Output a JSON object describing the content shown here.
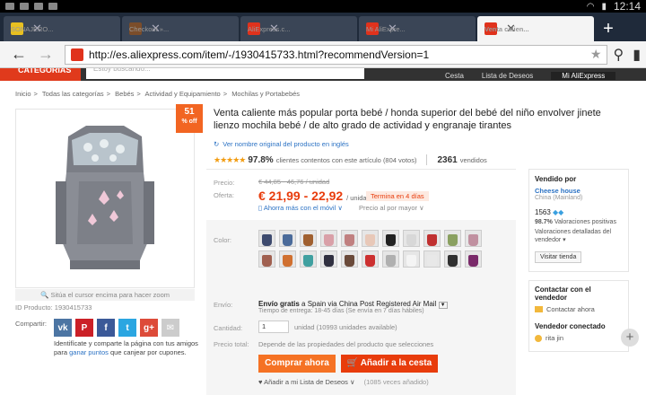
{
  "status": {
    "clock": "12:14"
  },
  "tabs": [
    {
      "label": "SONAJERO...",
      "color": "#e8c020",
      "active": false
    },
    {
      "label": "Checkout »...",
      "color": "#7b4d2a",
      "active": false
    },
    {
      "label": "AliExpress.c...",
      "color": "#e0321c",
      "active": false
    },
    {
      "label": "Mi AliExpre...",
      "color": "#e0321c",
      "active": false
    },
    {
      "label": "Venta calien...",
      "color": "#e0321c",
      "active": true
    }
  ],
  "url": "http://es.aliexpress.com/item/-/1930415733.html?recommendVersion=1",
  "header": {
    "categories": "CATEGORÍAS",
    "search_placeholder": "Estoy buscando...",
    "cart": "Cesta",
    "wishlist": "Lista de Deseos",
    "my": "Mi AliExpress"
  },
  "breadcrumb": [
    "Inicio",
    ">",
    "Todas las categorías",
    ">",
    "Bebés",
    ">",
    "Actividad y Equipamiento",
    ">",
    "Mochilas y Portabebés"
  ],
  "product": {
    "title": "Venta caliente más popular porta bebé / honda superior del bebé del niño envolver jinete lienzo mochila bebé / de alto grado de actividad y engranaje tirantes",
    "original_link": "Ver nombre original del producto en inglés",
    "stars": "★★★★★",
    "rating": "97.8%",
    "rating_text": "clientes contentos con este artículo (804 votos)",
    "sold_count": "2361",
    "sold_label": "vendidos",
    "discount_pct": "51",
    "discount_label": "% off",
    "price_label": "Precio:",
    "old_price": "€ 44,85 - 46,76",
    "old_unit": "/ unidad",
    "offer_label": "Oferta:",
    "price": "€ 21,99 - 22,92",
    "unit": "/ unidad",
    "timer": "Termina en 4 días",
    "mobile": "Ahorra más con el móvil",
    "bulk": "Precio al por mayor",
    "zoom_hint": "Sitúa el cursor encima para hacer zoom",
    "id_line": "ID Producto: 1930415733",
    "color_label": "Color:",
    "colors": [
      "#3d4a6e",
      "#4b6b9a",
      "#a06030",
      "#d9a0a8",
      "#c08080",
      "#e8c8b8",
      "#222222",
      "#d8d8d8",
      "#c03030",
      "#8aa060",
      "#c090a0",
      "#a06050",
      "#d07030",
      "#40a0a0",
      "#303040",
      "#6a4a3a",
      "#cc3030",
      "#b0b0b0",
      "#f4f4f4",
      "#e8e8e8",
      "#303030",
      "#7a2a6a"
    ],
    "ship_label": "Envío:",
    "ship_free": "Envío gratis",
    "ship_dest": "a   Spain via China Post Registered Air Mail",
    "ship_note": "Tiempo de entrega: 18-45 días (Se envía en 7 días hábiles)",
    "qty_label": "Cantidad:",
    "qty": "1",
    "qty_unit": "unidad (10993 unidades available)",
    "total_label": "Precio total:",
    "total_text": "Depende de las propiedades del producto que selecciones",
    "buy_now": "Comprar ahora",
    "add_cart": "Añadir a la cesta",
    "wishlist": "Añadir a mi Lista de Deseos ∨",
    "wish_count": "(1085 veces añadido)"
  },
  "share": {
    "label": "Compartir:",
    "note_1": "Identifícate y comparte la página con tus amigos para",
    "note_link": "ganar puntos",
    "note_2": "que canjear por cupones.",
    "icons": [
      {
        "name": "vk-icon",
        "glyph": "vk",
        "color": "#4c75a3"
      },
      {
        "name": "pinterest-icon",
        "glyph": "P",
        "color": "#cb2027"
      },
      {
        "name": "facebook-icon",
        "glyph": "f",
        "color": "#3b5998"
      },
      {
        "name": "twitter-icon",
        "glyph": "t",
        "color": "#2ba6e1"
      },
      {
        "name": "google-plus-icon",
        "glyph": "g+",
        "color": "#dd4b39"
      },
      {
        "name": "email-icon",
        "glyph": "✉",
        "color": "#cccccc"
      }
    ]
  },
  "seller": {
    "heading": "Vendido por",
    "store": "Cheese house",
    "country": "China (Mainland)",
    "score": "1563",
    "positive": "98.7%",
    "positive_text": "Valoraciones positivas",
    "detail": "Valoraciones detalladas del vendedor ▾",
    "visit": "Visitar tienda"
  },
  "contact": {
    "heading": "Contactar con el vendedor",
    "now": "Contactar ahora",
    "connected_heading": "Vendedor conectado",
    "name": "rita jin"
  }
}
